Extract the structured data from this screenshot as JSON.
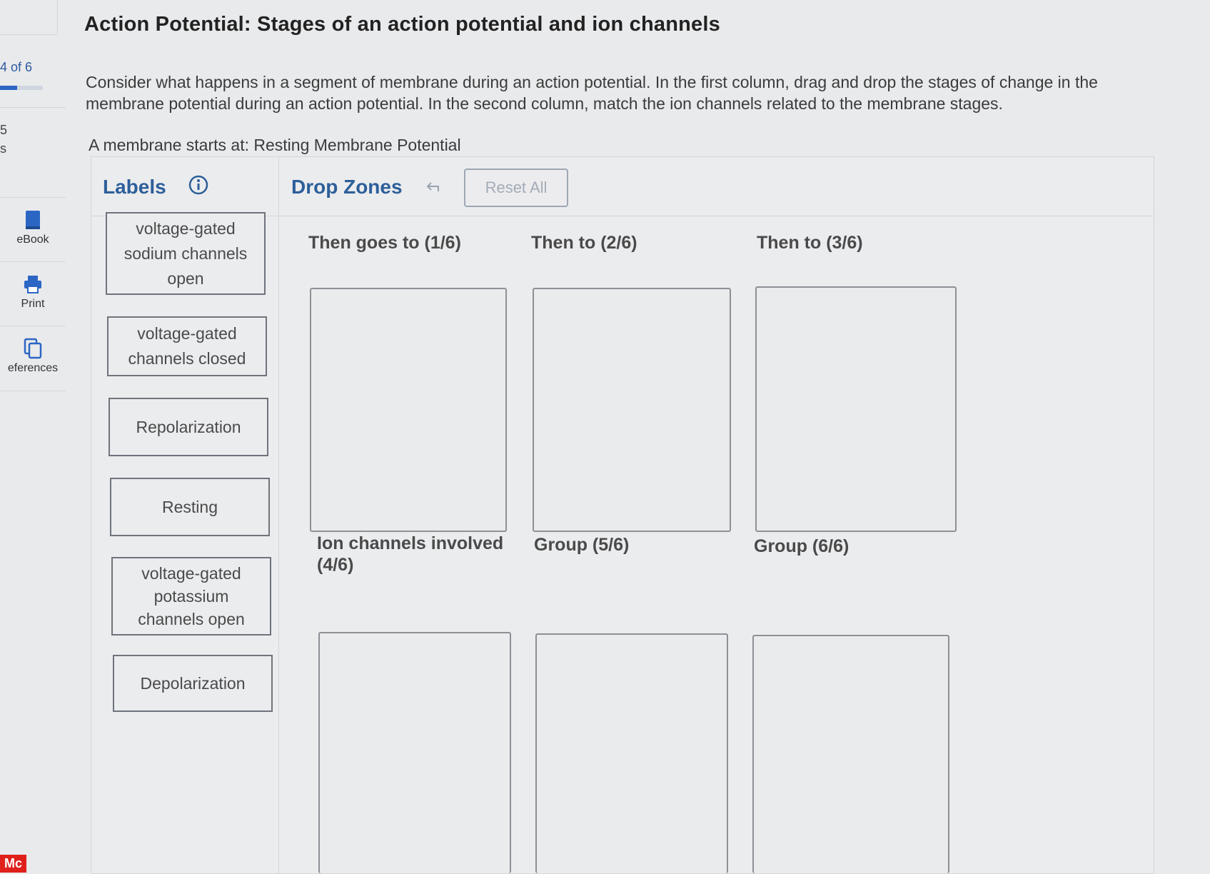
{
  "rail": {
    "question_counter": "4 of 6",
    "progress_fraction": 0.4,
    "fragment_1": "5",
    "fragment_2": "s",
    "tools": [
      {
        "label": "eBook",
        "icon": "book-icon"
      },
      {
        "label": "Print",
        "icon": "printer-icon"
      },
      {
        "label": "eferences",
        "icon": "copy-icon"
      }
    ],
    "brand": "Mc"
  },
  "question": {
    "title": "Action Potential: Stages of an action potential and ion channels",
    "prompt": "Consider what happens in a segment of membrane during an action potential. In the first column, drag and drop the stages of change in the membrane potential during an action potential. In the second column, match the ion channels related to the membrane stages.",
    "start_text": "A membrane starts at: Resting Membrane Potential"
  },
  "panel": {
    "labels_heading": "Labels",
    "drop_zones_heading": "Drop Zones",
    "reset_label": "Reset All",
    "labels": [
      "voltage-gated sodium channels open",
      "voltage-gated channels closed",
      "Repolarization",
      "Resting",
      "voltage-gated potassium channels open",
      "Depolarization"
    ],
    "zones": [
      "Then goes to (1/6)",
      "Then to (2/6)",
      "Then to (3/6)",
      "Ion channels involved (4/6)",
      "Group (5/6)",
      "Group (6/6)"
    ]
  },
  "colors": {
    "accent": "#2d5f9a",
    "brand": "#e0201b"
  }
}
